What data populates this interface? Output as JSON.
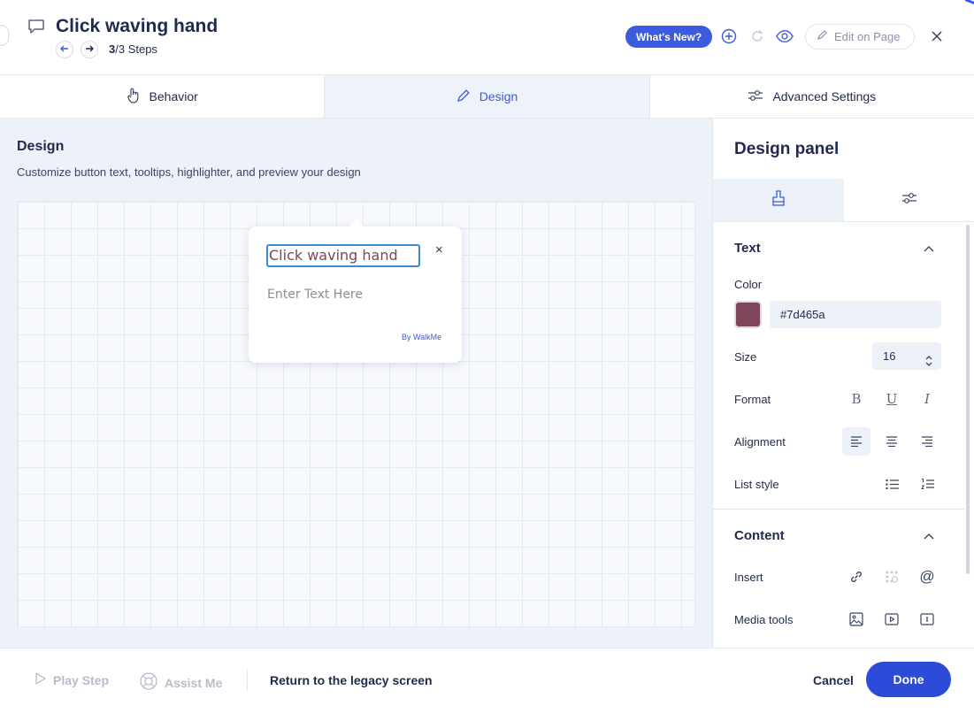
{
  "header": {
    "title": "Click waving hand",
    "steps_current": "3",
    "steps_rest": "/3 Steps",
    "whats_new_label": "What's New?",
    "edit_on_page_label": "Edit on Page",
    "icons": [
      "speech-bubble-icon",
      "arrow-left-icon",
      "arrow-right-icon",
      "add-circle-icon",
      "refresh-icon",
      "eye-icon",
      "pencil-icon",
      "close-icon"
    ]
  },
  "tabs": [
    {
      "label": "Behavior",
      "icon": "hand-pointer-icon",
      "active": false
    },
    {
      "label": "Design",
      "icon": "pencil-icon",
      "active": true
    },
    {
      "label": "Advanced Settings",
      "icon": "sliders-icon",
      "active": false
    }
  ],
  "main": {
    "title": "Design",
    "subtitle": "Customize button text, tooltips, highlighter, and preview your design",
    "tooltip": {
      "title_value": "Click waving hand",
      "body_placeholder": "Enter Text Here",
      "brand": "By WalkMe",
      "close_symbol": "×"
    }
  },
  "panel": {
    "title": "Design panel",
    "tab_icons": [
      "brush-icon",
      "sliders-icon"
    ],
    "text_section": {
      "title": "Text",
      "color_label": "Color",
      "color_value": "#7d465a",
      "size_label": "Size",
      "size_value": "16",
      "format_label": "Format",
      "alignment_label": "Alignment",
      "list_style_label": "List style"
    },
    "content_section": {
      "title": "Content",
      "insert_label": "Insert",
      "media_label": "Media tools"
    }
  },
  "footer": {
    "play_step": "Play Step",
    "assist_me": "Assist Me",
    "legacy": "Return to the legacy screen",
    "cancel": "Cancel",
    "done": "Done"
  },
  "colors": {
    "accent": "#3c5bdf",
    "done_button": "#2c4bd8",
    "text_color_swatch": "#7d465a",
    "canvas_bg": "#edf1f8"
  }
}
